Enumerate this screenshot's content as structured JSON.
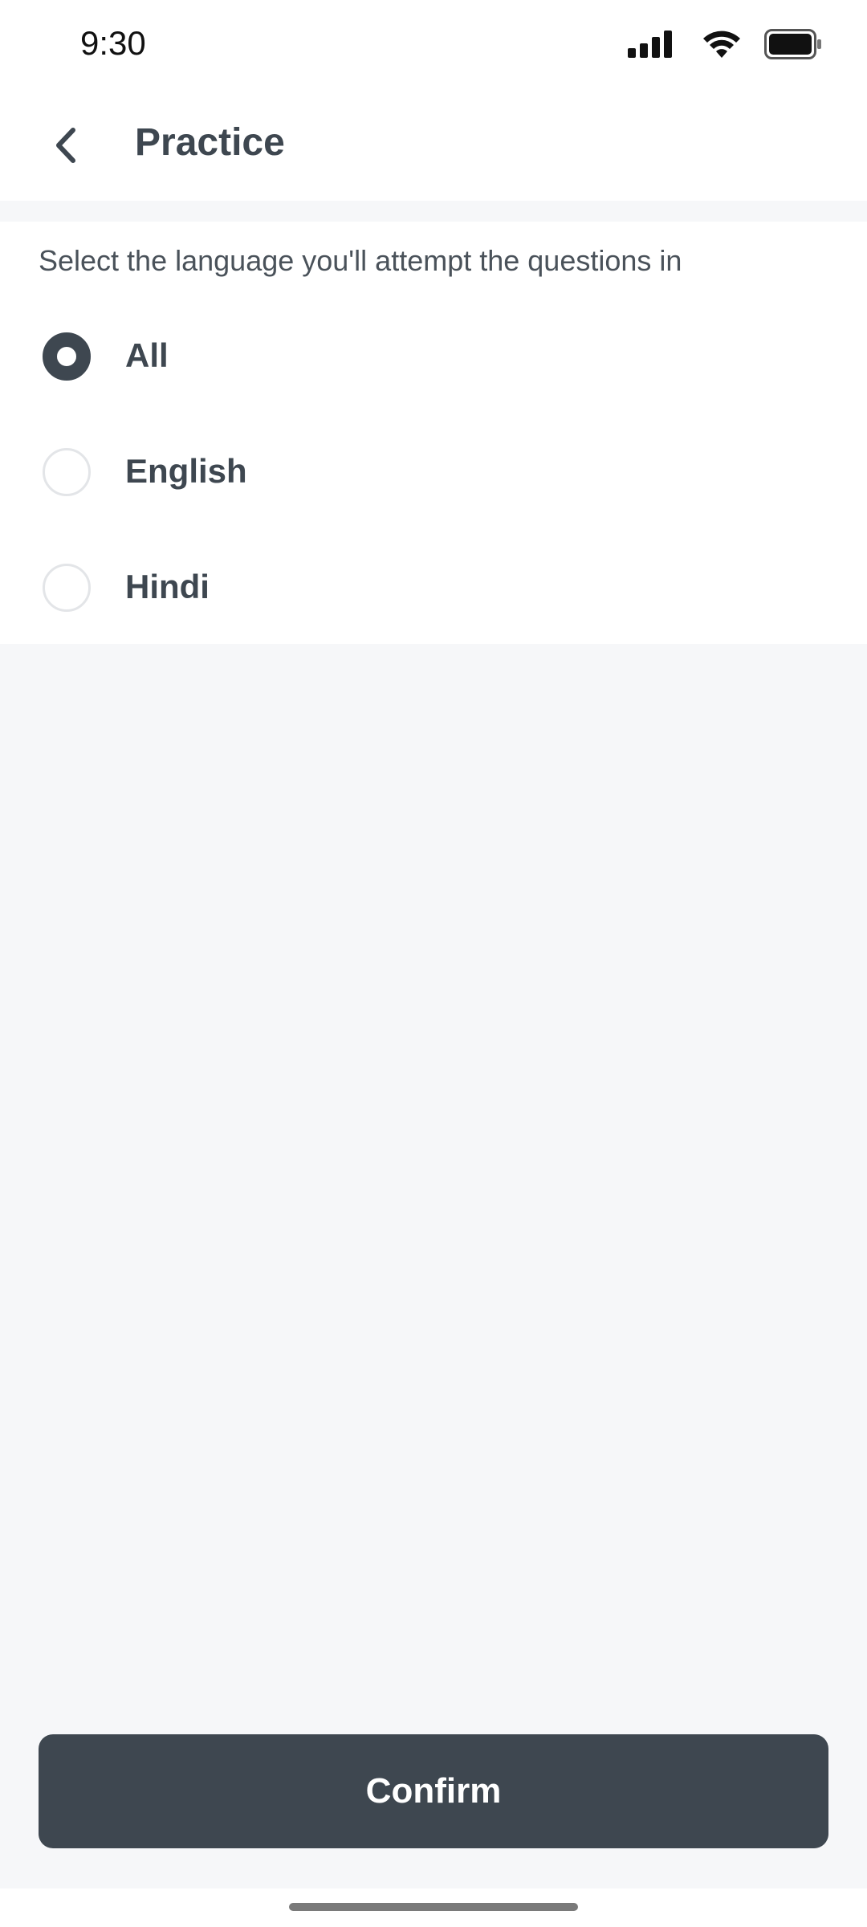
{
  "status_bar": {
    "time": "9:30"
  },
  "header": {
    "title": "Practice"
  },
  "language_selector": {
    "instruction": "Select the language you'll attempt the questions in",
    "options": [
      {
        "label": "All",
        "selected": true
      },
      {
        "label": "English",
        "selected": false
      },
      {
        "label": "Hindi",
        "selected": false
      }
    ]
  },
  "actions": {
    "confirm_label": "Confirm"
  },
  "icons": {
    "back": "chevron-left-icon",
    "signal": "cellular-signal-icon",
    "wifi": "wifi-icon",
    "battery": "battery-icon"
  },
  "colors": {
    "primary": "#3e4750",
    "background": "#f6f7f9",
    "surface": "#ffffff"
  }
}
